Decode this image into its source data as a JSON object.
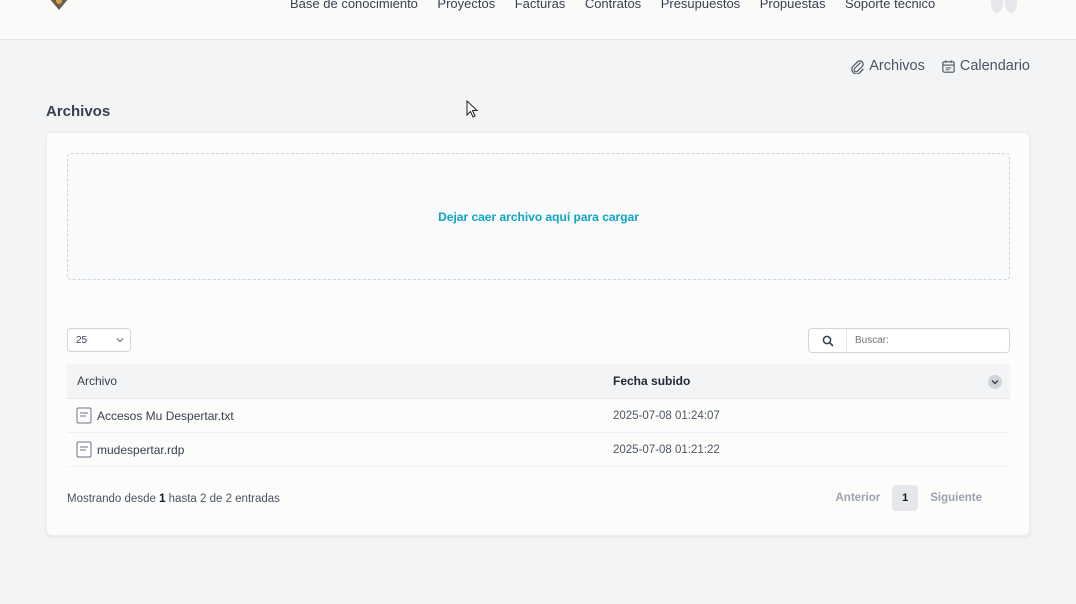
{
  "nav": {
    "items": [
      {
        "label": "Base de conocimiento"
      },
      {
        "label": "Proyectos"
      },
      {
        "label": "Facturas"
      },
      {
        "label": "Contratos"
      },
      {
        "label": "Presupuestos"
      },
      {
        "label": "Propuestas"
      },
      {
        "label": "Soporte técnico"
      }
    ]
  },
  "top_actions": {
    "files": "Archivos",
    "calendar": "Calendario"
  },
  "page_title": "Archivos",
  "dropzone": {
    "text": "Dejar caer archivo aquí para cargar"
  },
  "length_select": {
    "value": "25"
  },
  "search": {
    "placeholder": "Buscar:"
  },
  "table": {
    "headers": {
      "file": "Archivo",
      "date": "Fecha subido"
    },
    "rows": [
      {
        "file": "Accesos Mu Despertar.txt",
        "date": "2025-07-08 01:24:07"
      },
      {
        "file": "mudespertar.rdp",
        "date": "2025-07-08 01:21:22"
      }
    ]
  },
  "info": {
    "prefix": "Mostrando desde ",
    "from": "1",
    "mid": " hasta 2 de 2 entradas"
  },
  "pagination": {
    "prev": "Anterior",
    "current": "1",
    "next": "Siguiente"
  },
  "colors": {
    "accent": "#0ea5c6",
    "background": "#f3f4f6"
  }
}
